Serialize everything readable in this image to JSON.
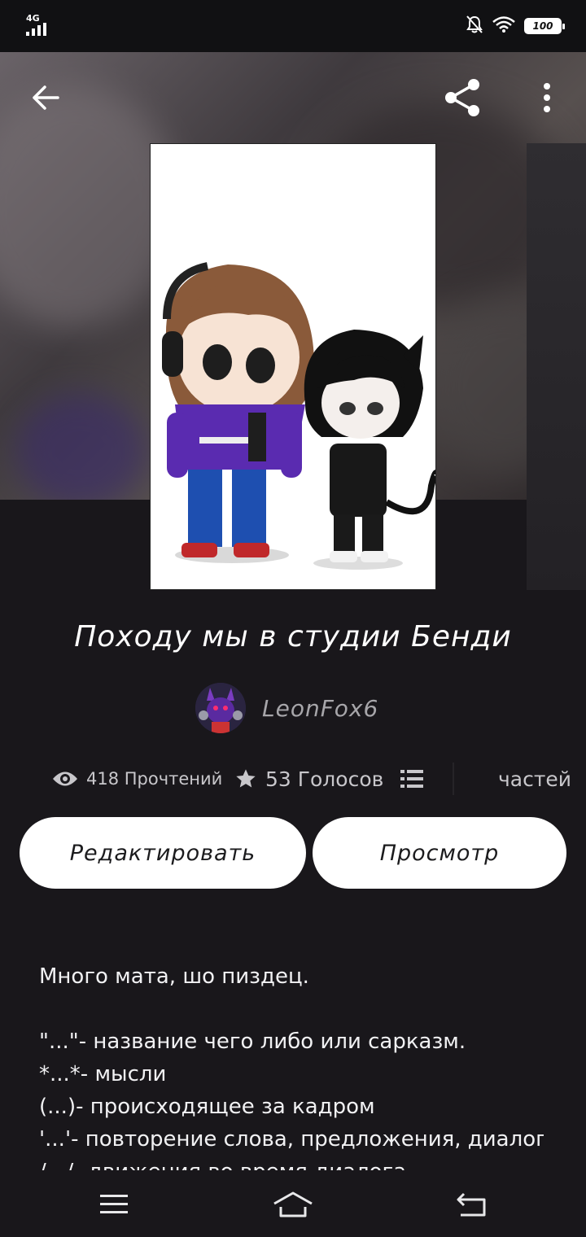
{
  "status_bar": {
    "network": "4G",
    "battery": "100"
  },
  "header": {
    "back_icon": "arrow-left-icon",
    "share_icon": "share-icon",
    "more_icon": "more-vertical-icon"
  },
  "story": {
    "title": "Походу мы в студии Бенди",
    "author": "LeonFox6",
    "stats": {
      "reads": "418 Прочтений",
      "votes": "53 Голосов",
      "parts": "частей"
    },
    "actions": {
      "edit_label": "Редактировать",
      "view_label": "Просмотр"
    },
    "description_lines": [
      "Много мата, шо пиздец.",
      "",
      "\"...\"- название чего либо или сарказм.",
      "*...*- мысли",
      "(...)- происходящее за кадром",
      "'...'- повторение слова, предложения, диалога",
      "/.../- движения во время диалога"
    ]
  },
  "navigation": {
    "menu_icon": "menu-icon",
    "home_icon": "home-icon",
    "back_icon": "back-icon"
  },
  "colors": {
    "background": "#19171b",
    "button_bg": "#ffffff",
    "muted_text": "#a7a6aa"
  }
}
